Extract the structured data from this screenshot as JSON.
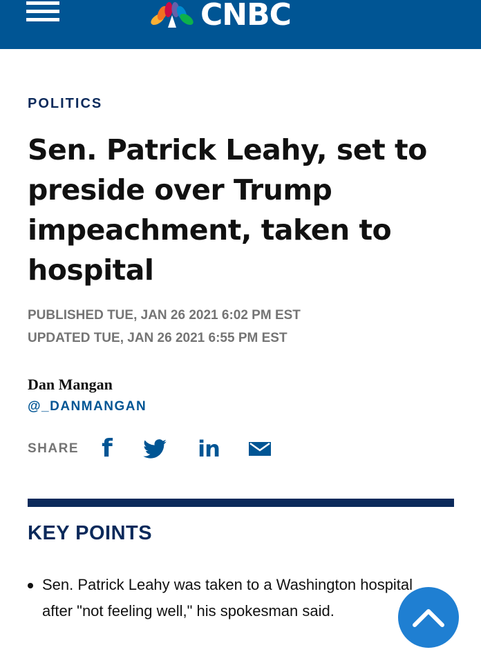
{
  "header": {
    "logo_text": "CNBC",
    "logo_peacock_colors": [
      "#fbb034",
      "#f37021",
      "#cb0c45",
      "#6460aa",
      "#0089cf",
      "#0db14b"
    ],
    "background_color": "#005594"
  },
  "article": {
    "section": "POLITICS",
    "headline": "Sen. Patrick Leahy, set to preside over Trump impeachment, taken to hospital",
    "published": "PUBLISHED TUE, JAN 26 2021 6:02 PM EST",
    "updated": "UPDATED TUE, JAN 26 2021 6:55 PM EST",
    "author_name": "Dan Mangan",
    "author_handle": "@_DANMANGAN"
  },
  "share": {
    "label": "SHARE",
    "icons": [
      "facebook-icon",
      "twitter-icon",
      "linkedin-icon",
      "email-icon"
    ],
    "facebook_glyph": "f",
    "linkedin_glyph": "in"
  },
  "key_points": {
    "title": "KEY POINTS",
    "items": [
      "Sen. Patrick Leahy was taken to a Washington hospital after \"not feeling well,\" his spokesman said."
    ]
  },
  "colors": {
    "brand_blue": "#005594",
    "navy": "#0b2a5b",
    "meta_gray": "#747474",
    "scroll_button": "#1f7fd2"
  }
}
